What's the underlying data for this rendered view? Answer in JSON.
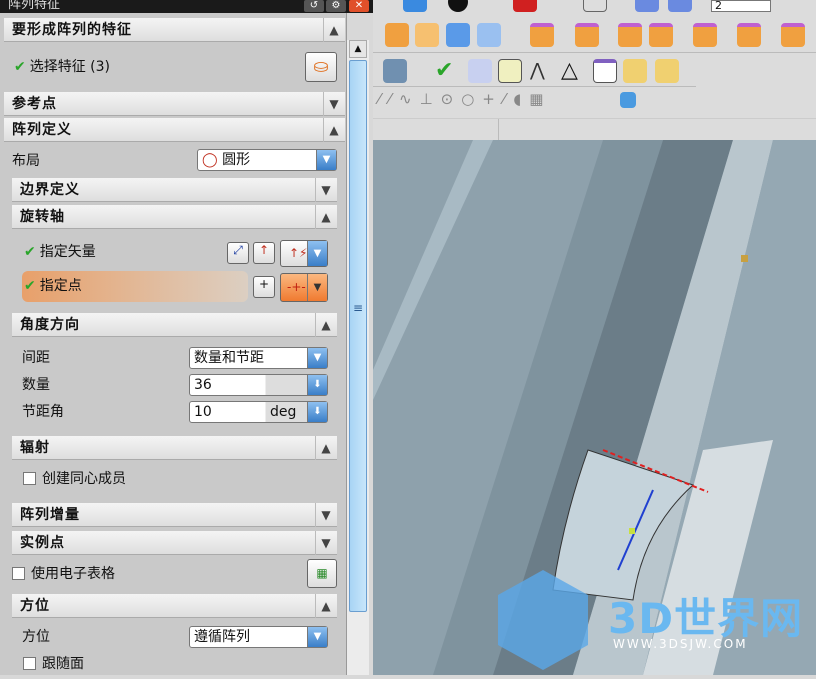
{
  "dialog": {
    "title": "阵列特征",
    "title_buttons": [
      "reset",
      "settings",
      "close"
    ]
  },
  "sections": {
    "features": {
      "title": "要形成阵列的特征",
      "select_label": "选择特征 (3)"
    },
    "reference": {
      "title": "参考点"
    },
    "definition": {
      "title": "阵列定义",
      "layout_label": "布局",
      "layout_value": "圆形"
    },
    "boundary": {
      "title": "边界定义"
    },
    "axis": {
      "title": "旋转轴",
      "vector_label": "指定矢量",
      "point_label": "指定点"
    },
    "angle": {
      "title": "角度方向",
      "spacing_label": "间距",
      "spacing_value": "数量和节距",
      "count_label": "数量",
      "count_value": "36",
      "pitch_label": "节距角",
      "pitch_value": "10",
      "pitch_unit": "deg"
    },
    "radiation": {
      "title": "辐射",
      "concentric_label": "创建同心成员"
    },
    "increment": {
      "title": "阵列增量"
    },
    "instance": {
      "title": "实例点"
    },
    "spreadsheet": {
      "label": "使用电子表格"
    },
    "orientation": {
      "title": "方位",
      "orient_label": "方位",
      "orient_value": "遵循阵列",
      "follow_face_label": "跟随面"
    }
  },
  "toolbar": {
    "zoom_value": "2"
  },
  "watermark": {
    "brand": "3D世界网",
    "url": "WWW.3DSJW.COM"
  },
  "colors": {
    "accent": "#e8a06a",
    "check": "#2aa52a"
  }
}
